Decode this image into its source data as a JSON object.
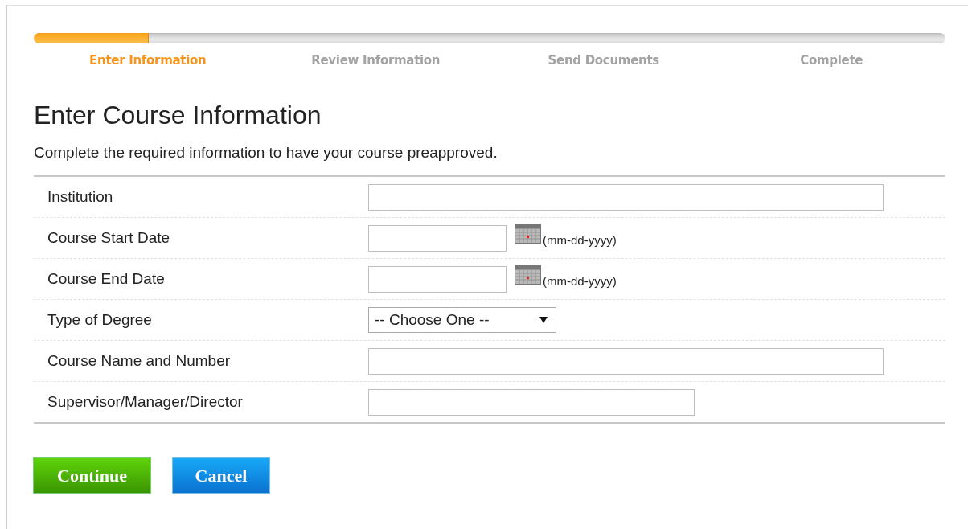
{
  "progress": {
    "level": 0.126
  },
  "steps": [
    {
      "label": "Enter Information",
      "selected": true
    },
    {
      "label": "Review Information",
      "selected": false
    },
    {
      "label": "Send Documents",
      "selected": false
    },
    {
      "label": "Complete",
      "selected": false
    }
  ],
  "heading": "Enter Course Information",
  "description": "Complete the required information to have your course preapproved.",
  "fields": [
    {
      "label": "Institution",
      "kind": "long"
    },
    {
      "label": "Course Start Date",
      "kind": "date",
      "hint": "(mm-dd-yyyy)"
    },
    {
      "label": "Course End Date",
      "kind": "date",
      "hint": "(mm-dd-yyyy)"
    },
    {
      "label": "Type of Degree",
      "kind": "select",
      "value": "-- Choose One --"
    },
    {
      "label": "Course Name and Number",
      "kind": "long"
    },
    {
      "label": "Supervisor/Manager/Director",
      "kind": "medium"
    }
  ],
  "buttons": [
    {
      "label": "Continue",
      "kind": "primary"
    },
    {
      "label": "Cancel",
      "kind": "secondary"
    }
  ]
}
